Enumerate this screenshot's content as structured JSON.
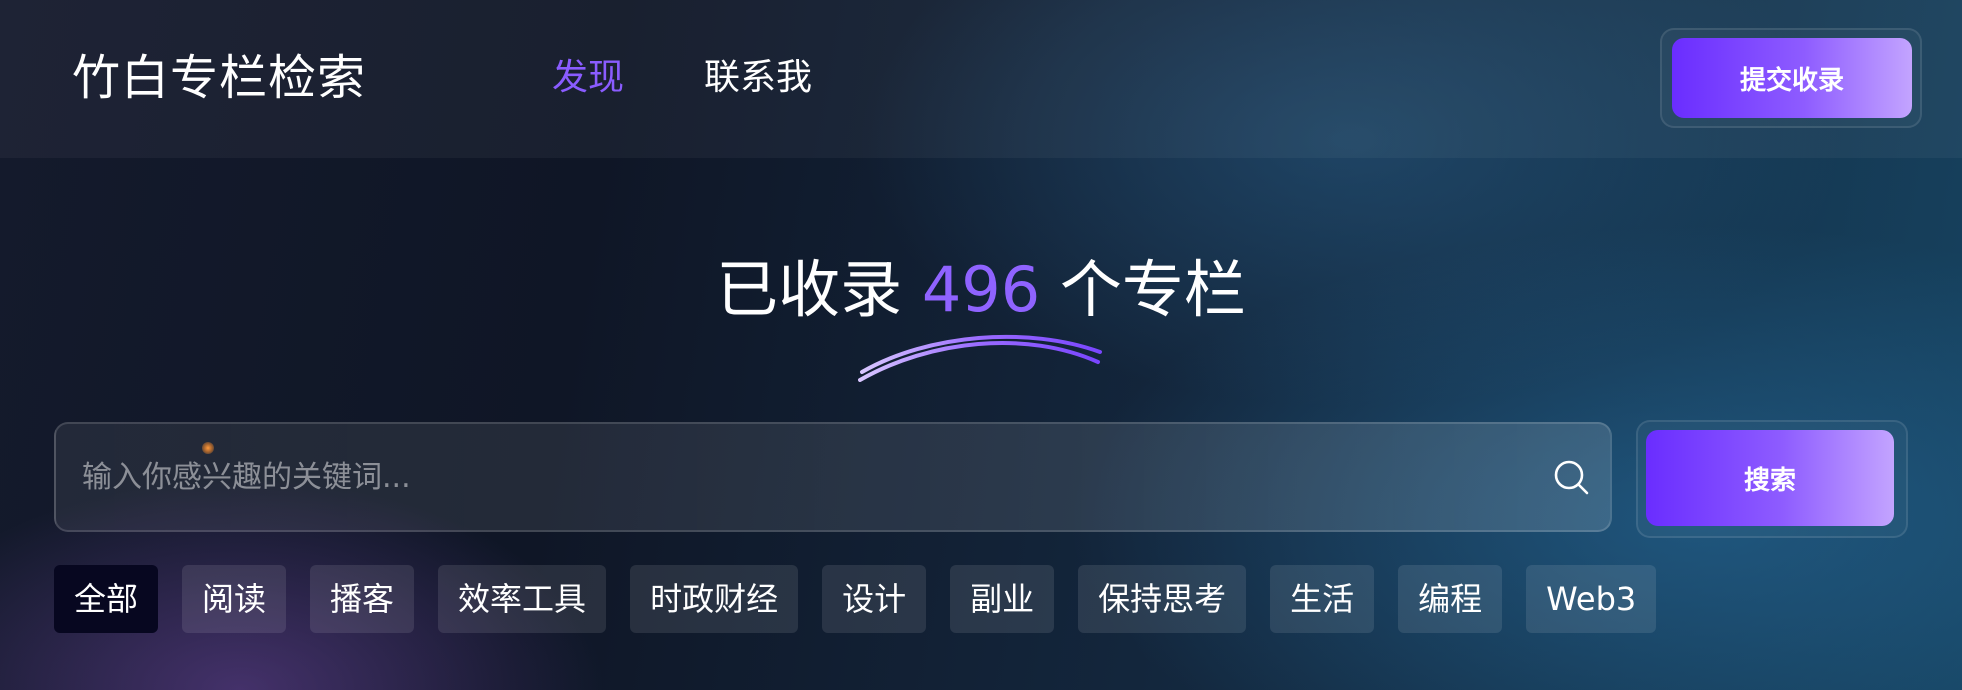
{
  "header": {
    "brand": "竹白专栏检索",
    "nav": [
      {
        "label": "发现",
        "active": true
      },
      {
        "label": "联系我",
        "active": false
      }
    ],
    "submit_label": "提交收录"
  },
  "hero": {
    "prefix": "已收录 ",
    "count": "496",
    "suffix": " 个专栏"
  },
  "search": {
    "placeholder": "输入你感兴趣的关键词...",
    "value": "",
    "button_label": "搜索",
    "icon": "search-icon"
  },
  "tags": [
    {
      "label": "全部",
      "active": true
    },
    {
      "label": "阅读",
      "active": false
    },
    {
      "label": "播客",
      "active": false
    },
    {
      "label": "效率工具",
      "active": false
    },
    {
      "label": "时政财经",
      "active": false
    },
    {
      "label": "设计",
      "active": false
    },
    {
      "label": "副业",
      "active": false
    },
    {
      "label": "保持思考",
      "active": false
    },
    {
      "label": "生活",
      "active": false
    },
    {
      "label": "编程",
      "active": false
    },
    {
      "label": "Web3",
      "active": false
    }
  ],
  "colors": {
    "accent": "#8a5cff",
    "button_gradient_start": "#6a2dff",
    "button_gradient_end": "#c3a4ff",
    "active_tag_bg": "#070720"
  }
}
